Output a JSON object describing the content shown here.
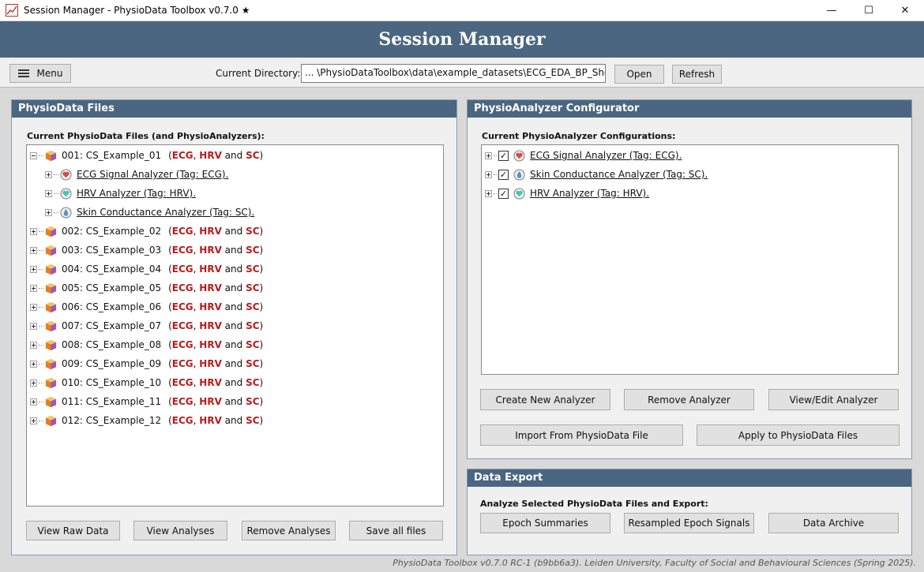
{
  "window": {
    "title": "Session Manager - PhysioData Toolbox v0.7.0 ★",
    "min_glyph": "—",
    "max_glyph": "☐",
    "close_glyph": "✕"
  },
  "banner": {
    "title": "Session Manager"
  },
  "toolbar": {
    "menu_label": "Menu",
    "dir_label": "Current Directory:",
    "dir_value": "... \\PhysioDataToolbox\\data\\example_datasets\\ECG_EDA_BP_ShockCS\\",
    "open_label": "Open",
    "refresh_label": "Refresh"
  },
  "files_panel": {
    "title": "PhysioData Files",
    "list_label": "Current PhysioData Files (and PhysioAnalyzers):",
    "expanded_file": {
      "name": "001: CS_Example_01",
      "open": "(",
      "tag1": "ECG",
      "sep1": ", ",
      "tag2": "HRV",
      "sep2": " and ",
      "tag3": "SC",
      "close": ")",
      "analyzers": [
        {
          "label": "ECG Signal Analyzer (Tag: ECG).",
          "icon": "heart-icon"
        },
        {
          "label": "HRV Analyzer (Tag: HRV).",
          "icon": "hrv-heart-icon"
        },
        {
          "label": "Skin Conductance Analyzer (Tag: SC).",
          "icon": "droplet-icon"
        }
      ]
    },
    "files": [
      {
        "name": "002: CS_Example_02"
      },
      {
        "name": "003: CS_Example_03"
      },
      {
        "name": "004: CS_Example_04"
      },
      {
        "name": "005: CS_Example_05"
      },
      {
        "name": "006: CS_Example_06"
      },
      {
        "name": "007: CS_Example_07"
      },
      {
        "name": "008: CS_Example_08"
      },
      {
        "name": "009: CS_Example_09"
      },
      {
        "name": "010: CS_Example_10"
      },
      {
        "name": "011: CS_Example_11"
      },
      {
        "name": "012: CS_Example_12"
      }
    ],
    "tags": {
      "open": "(",
      "t1": "ECG",
      "s1": ", ",
      "t2": "HRV",
      "s2": " and ",
      "t3": "SC",
      "close": ")"
    },
    "buttons": {
      "view_raw": "View Raw Data",
      "view_analyses": "View Analyses",
      "remove_analyses": "Remove Analyses",
      "save_all": "Save all files"
    }
  },
  "configurator_panel": {
    "title": "PhysioAnalyzer Configurator",
    "list_label": "Current PhysioAnalyzer Configurations:",
    "configs": [
      {
        "label": "ECG Signal Analyzer (Tag: ECG).",
        "checked": true,
        "icon": "heart-icon"
      },
      {
        "label": "Skin Conductance Analyzer (Tag: SC).",
        "checked": true,
        "icon": "droplet-icon"
      },
      {
        "label": "HRV Analyzer (Tag: HRV).",
        "checked": true,
        "icon": "hrv-heart-icon"
      }
    ],
    "check_glyph": "✓",
    "buttons": {
      "create": "Create New Analyzer",
      "remove": "Remove Analyzer",
      "view_edit": "View/Edit Analyzer",
      "import": "Import From PhysioData File",
      "apply": "Apply to PhysioData Files"
    }
  },
  "export_panel": {
    "title": "Data Export",
    "label": "Analyze Selected PhysioData Files and Export:",
    "buttons": {
      "epoch_summaries": "Epoch Summaries",
      "resampled": "Resampled Epoch Signals",
      "archive": "Data Archive"
    }
  },
  "footer": {
    "text": "PhysioData Toolbox v0.7.0 RC-1 (b9bb6a3). Leiden University, Faculty of Social and Behavioural Sciences (Spring 2025)."
  },
  "colors": {
    "header": "#4a6680",
    "tag": "#b71c1c",
    "heart": "#d84b4b",
    "hrv": "#43c4b4",
    "droplet": "#5a8fd0"
  }
}
